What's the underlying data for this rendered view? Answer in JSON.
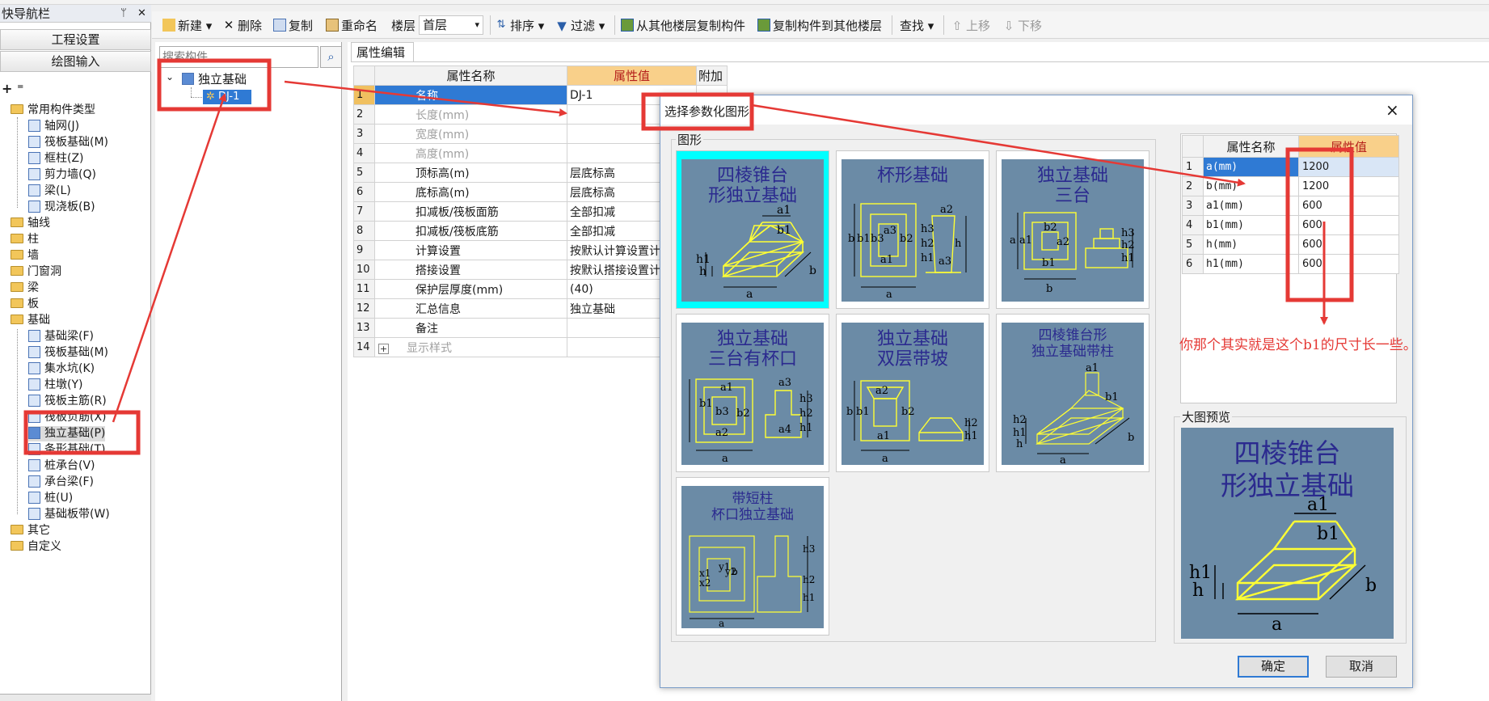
{
  "navigation_panel": {
    "title": "快导航栏",
    "buttons": [
      "工程设置",
      "绘图输入"
    ],
    "tree": [
      {
        "label": "常用构件类型",
        "type": "folder"
      },
      {
        "label": "轴网(J)",
        "type": "item"
      },
      {
        "label": "筏板基础(M)",
        "type": "item"
      },
      {
        "label": "框柱(Z)",
        "type": "item"
      },
      {
        "label": "剪力墙(Q)",
        "type": "item"
      },
      {
        "label": "梁(L)",
        "type": "item"
      },
      {
        "label": "现浇板(B)",
        "type": "item"
      },
      {
        "label": "轴线",
        "type": "folder"
      },
      {
        "label": "柱",
        "type": "folder"
      },
      {
        "label": "墙",
        "type": "folder"
      },
      {
        "label": "门窗洞",
        "type": "folder"
      },
      {
        "label": "梁",
        "type": "folder"
      },
      {
        "label": "板",
        "type": "folder"
      },
      {
        "label": "基础",
        "type": "folder"
      },
      {
        "label": "基础梁(F)",
        "type": "item"
      },
      {
        "label": "筏板基础(M)",
        "type": "item"
      },
      {
        "label": "集水坑(K)",
        "type": "item"
      },
      {
        "label": "柱墩(Y)",
        "type": "item"
      },
      {
        "label": "筏板主筋(R)",
        "type": "item"
      },
      {
        "label": "筏板负筋(X)",
        "type": "item"
      },
      {
        "label": "独立基础(P)",
        "type": "item",
        "selected": true
      },
      {
        "label": "条形基础(T)",
        "type": "item"
      },
      {
        "label": "桩承台(V)",
        "type": "item"
      },
      {
        "label": "承台梁(F)",
        "type": "item"
      },
      {
        "label": "桩(U)",
        "type": "item"
      },
      {
        "label": "基础板带(W)",
        "type": "item"
      },
      {
        "label": "其它",
        "type": "folder"
      },
      {
        "label": "自定义",
        "type": "folder"
      }
    ]
  },
  "toolbar": {
    "new": "新建",
    "delete": "删除",
    "copy": "复制",
    "rename": "重命名",
    "floor_label": "楼层",
    "floor_value": "首层",
    "sort": "排序",
    "filter": "过滤",
    "copy_from_other_floors": "从其他楼层复制构件",
    "copy_to_other_floors": "复制构件到其他楼层",
    "find": "查找",
    "move_up": "上移",
    "move_down": "下移"
  },
  "component_list": {
    "search_placeholder": "搜索构件...",
    "group": "独立基础",
    "item": "DJ-1"
  },
  "property_editor": {
    "tab": "属性编辑",
    "headers": {
      "name": "属性名称",
      "value": "属性值",
      "extra": "附加"
    },
    "rows": [
      {
        "n": "1",
        "name": "名称",
        "value": "DJ-1"
      },
      {
        "n": "2",
        "name": "长度(mm)",
        "value": ""
      },
      {
        "n": "3",
        "name": "宽度(mm)",
        "value": ""
      },
      {
        "n": "4",
        "name": "高度(mm)",
        "value": ""
      },
      {
        "n": "5",
        "name": "顶标高(m)",
        "value": "层底标高"
      },
      {
        "n": "6",
        "name": "底标高(m)",
        "value": "层底标高"
      },
      {
        "n": "7",
        "name": "扣减板/筏板面筋",
        "value": "全部扣减"
      },
      {
        "n": "8",
        "name": "扣减板/筏板底筋",
        "value": "全部扣减"
      },
      {
        "n": "9",
        "name": "计算设置",
        "value": "按默认计算设置计"
      },
      {
        "n": "10",
        "name": "搭接设置",
        "value": "按默认搭接设置计"
      },
      {
        "n": "11",
        "name": "保护层厚度(mm)",
        "value": "(40)"
      },
      {
        "n": "12",
        "name": "汇总信息",
        "value": "独立基础"
      },
      {
        "n": "13",
        "name": "备注",
        "value": ""
      },
      {
        "n": "14",
        "name": "显示样式",
        "value": "",
        "expand": "+"
      }
    ]
  },
  "dialog": {
    "title": "选择参数化图形",
    "close": "×",
    "shapes_label": "图形",
    "shapes": [
      {
        "title": "四棱锥台形独立基础",
        "lines": [
          "四棱锥台",
          "形独立基础"
        ],
        "dims": [
          "a1",
          "b1",
          "h1",
          "h",
          "a",
          "b"
        ]
      },
      {
        "title": "杯形基础",
        "lines": [
          "杯形基础"
        ],
        "dims": [
          "a2",
          "b",
          "b1",
          "b3",
          "a3",
          "b2",
          "h3",
          "h2",
          "h1",
          "h",
          "a1",
          "a3",
          "a"
        ]
      },
      {
        "title": "独立基础三台",
        "lines": [
          "独立基础",
          "三台"
        ],
        "dims": [
          "a",
          "a1",
          "b2",
          "a2",
          "b1",
          "h3",
          "h2",
          "h1",
          "b"
        ]
      },
      {
        "title": "独立基础三台有杯口",
        "lines": [
          "独立基础",
          "三台有杯口"
        ],
        "dims": [
          "a1",
          "a3",
          "b1",
          "b3",
          "b2",
          "h3",
          "h2",
          "h1",
          "a2",
          "a4",
          "a"
        ]
      },
      {
        "title": "独立基础双层带坡",
        "lines": [
          "独立基础",
          "双层带坡"
        ],
        "dims": [
          "a2",
          "b",
          "b1",
          "b2",
          "h2",
          "h1",
          "a1",
          "a"
        ]
      },
      {
        "title": "四棱锥台形独立基础带柱",
        "lines": [
          "四棱锥台形",
          "独立基础带柱"
        ],
        "dims": [
          "a1",
          "b1",
          "h2",
          "h1",
          "h",
          "b",
          "a"
        ]
      },
      {
        "title": "带短柱杯口独立基础",
        "lines": [
          "带短柱",
          "杯口独立基础"
        ],
        "dims": [
          "x1",
          "x2",
          "y1",
          "y2",
          "h3",
          "h2",
          "h1",
          "a",
          "b"
        ]
      }
    ],
    "params": {
      "headers": {
        "name": "属性名称",
        "value": "属性值"
      },
      "rows": [
        {
          "n": "1",
          "name": "a(mm)",
          "value": "1200"
        },
        {
          "n": "2",
          "name": "b(mm)",
          "value": "1200"
        },
        {
          "n": "3",
          "name": "a1(mm)",
          "value": "600"
        },
        {
          "n": "4",
          "name": "b1(mm)",
          "value": "600"
        },
        {
          "n": "5",
          "name": "h(mm)",
          "value": "600"
        },
        {
          "n": "6",
          "name": "h1(mm)",
          "value": "600"
        }
      ]
    },
    "preview_label": "大图预览",
    "preview": {
      "lines": [
        "四棱锥台",
        "形独立基础"
      ],
      "dims": [
        "a1",
        "b1",
        "h1",
        "h",
        "a",
        "b"
      ]
    },
    "ok": "确定",
    "cancel": "取消"
  },
  "annotation": {
    "note": "你那个其实就是这个b1的尺寸长一些。",
    "color": "#e53935"
  }
}
